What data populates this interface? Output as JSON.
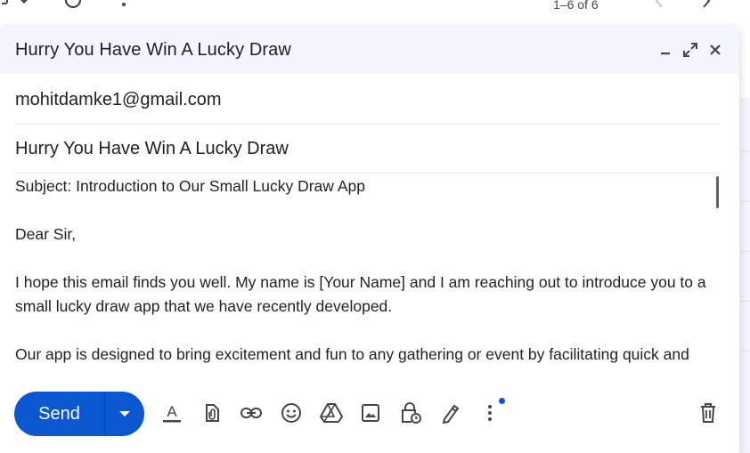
{
  "inbox": {
    "pagination": "1–6 of 6"
  },
  "compose": {
    "title": "Hurry You Have Win A Lucky Draw",
    "to": "mohitdamke1@gmail.com",
    "subject": "Hurry You Have Win A Lucky Draw",
    "body": [
      "Subject: Introduction to Our Small Lucky Draw App",
      "Dear Sir,",
      "I hope this email finds you well. My name is [Your Name] and I am reaching out to introduce you to a small lucky draw app that we have recently developed.",
      "Our app is designed to bring excitement and fun to any gathering or event by facilitating quick and"
    ],
    "send_label": "Send",
    "colors": {
      "accent": "#0b57d0",
      "header_bg": "#f2f6fc"
    },
    "icons": {
      "header": [
        "minimize-icon",
        "expand-icon",
        "close-icon"
      ],
      "toolbar": [
        "format-text-icon",
        "attach-file-icon",
        "insert-link-icon",
        "emoji-icon",
        "drive-icon",
        "insert-photo-icon",
        "confidential-mode-icon",
        "signature-icon",
        "more-options-icon",
        "discard-draft-icon"
      ]
    }
  }
}
